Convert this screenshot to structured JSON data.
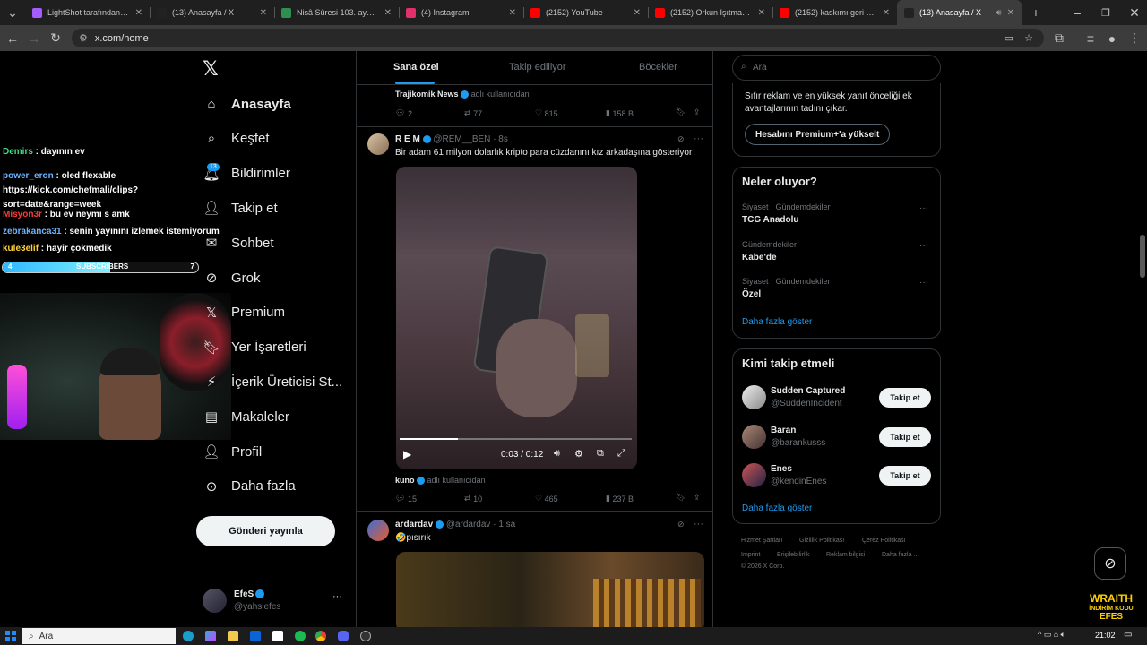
{
  "tabs": [
    {
      "title": "LightShot tarafından Ekra",
      "color": "#a45cff"
    },
    {
      "title": "(13) Anasayfa / X",
      "color": "#222"
    },
    {
      "title": "Nisâ Sûresi 103. ayeti ve t",
      "color": "#2f8f4e"
    },
    {
      "title": "(4) Instagram",
      "color": "#e1306c"
    },
    {
      "title": "(2152) YouTube",
      "color": "#ff0000"
    },
    {
      "title": "(2152) Orkun Işıtmak\"Kür",
      "color": "#ff0000"
    },
    {
      "title": "(2152) kaskımı geri ver or",
      "color": "#ff0000"
    },
    {
      "title": "(13) Anasayfa / X",
      "color": "#222"
    }
  ],
  "url": "x.com/home",
  "nav": {
    "items": [
      {
        "label": "Anasayfa",
        "icon": "home-icon"
      },
      {
        "label": "Keşfet",
        "icon": "search-icon"
      },
      {
        "label": "Bildirimler",
        "icon": "bell-icon",
        "badge": "13"
      },
      {
        "label": "Takip et",
        "icon": "person-add-icon"
      },
      {
        "label": "Sohbet",
        "icon": "chat-icon"
      },
      {
        "label": "Grok",
        "icon": "grok-icon"
      },
      {
        "label": "Premium",
        "icon": "x-icon"
      },
      {
        "label": "Yer İşaretleri",
        "icon": "bookmark-icon"
      },
      {
        "label": "İçerik Üreticisi St...",
        "icon": "studio-icon"
      },
      {
        "label": "Makaleler",
        "icon": "article-icon"
      },
      {
        "label": "Profil",
        "icon": "person-icon"
      },
      {
        "label": "Daha fazla",
        "icon": "more-circle-icon"
      }
    ],
    "post_button": "Gönderi yayınla",
    "account": {
      "name": "EfeS",
      "handle": "@yahslefes"
    }
  },
  "stream": {
    "chat": [
      {
        "user": "Demirs",
        "msg": "dayının ev",
        "color": "#3ddc84"
      },
      {
        "user": "power_eron",
        "msg": "oled flexable https://kick.com/chefmali/clips?sort=date&range=week",
        "color": "#6cb4ff"
      },
      {
        "user": "Misyon3r",
        "msg": "bu ev neymı s amk",
        "color": "#ff3b3b"
      },
      {
        "user": "zebrakanca31",
        "msg": "senin yayınını izlemek istemiyorum",
        "color": "#6cb4ff"
      },
      {
        "user": "kule3elif",
        "msg": "hayir çokmedik",
        "color": "#ffd23b"
      }
    ],
    "sub_left": "4",
    "sub_label": "SUBSCRIBERS",
    "sub_right": "7",
    "sub_progress": 0.55,
    "promo_line1": "WRAITH",
    "promo_line2": "İNDİRİM KODU",
    "promo_line3": "EFES"
  },
  "feed": {
    "tabs": [
      "Sana özel",
      "Takip ediliyor",
      "Böcekler"
    ],
    "post0": {
      "source": "Trajikomik News",
      "source_suffix": "adlı kullanıcıdan",
      "replies": "2",
      "reposts": "77",
      "likes": "815",
      "views": "158 B"
    },
    "post1": {
      "name": "R E M",
      "handle": "@REM__BEN",
      "time": "· 8s",
      "text": "Bir adam 61 milyon dolarlık kripto para cüzdanını kız arkadaşına gösteriyor",
      "video_time": "0:03 / 0:12",
      "video_progress": 0.25,
      "source": "kuno",
      "source_suffix": "adlı kullanıcıdan",
      "replies": "15",
      "reposts": "10",
      "likes": "465",
      "views": "237 B"
    },
    "post2": {
      "name": "ardardav",
      "handle": "@ardardav",
      "time": "· 1 sa",
      "text": "🤣pısırık"
    }
  },
  "right": {
    "search_placeholder": "Ara",
    "premium_text": "Sıfır reklam ve en yüksek yanıt önceliği ek avantajlarının tadını çıkar.",
    "premium_button": "Hesabını Premium+'a yükselt",
    "trends_title": "Neler oluyor?",
    "trends": [
      {
        "category": "Siyaset · Gündemdekiler",
        "name": "TCG Anadolu"
      },
      {
        "category": "Gündemdekiler",
        "name": "Kabe'de"
      },
      {
        "category": "Siyaset · Gündemdekiler",
        "name": "Özel"
      }
    ],
    "trends_more": "Daha fazla göster",
    "follow_title": "Kimi takip etmeli",
    "follow": [
      {
        "name": "Sudden Captured",
        "handle": "@SuddenIncident",
        "button": "Takip et"
      },
      {
        "name": "Baran",
        "handle": "@barankusss",
        "button": "Takip et"
      },
      {
        "name": "Enes",
        "handle": "@kendinEnes",
        "button": "Takip et"
      }
    ],
    "follow_more": "Daha fazla göster",
    "footer": [
      "Hizmet Şartları",
      "Gizlilik Politikası",
      "Çerez Politikası",
      "Imprint",
      "Erişilebilirlik",
      "Reklam bilgisi",
      "Daha fazla ...",
      "© 2026 X Corp."
    ]
  },
  "taskbar": {
    "search": "Ara",
    "time": "21:02"
  }
}
